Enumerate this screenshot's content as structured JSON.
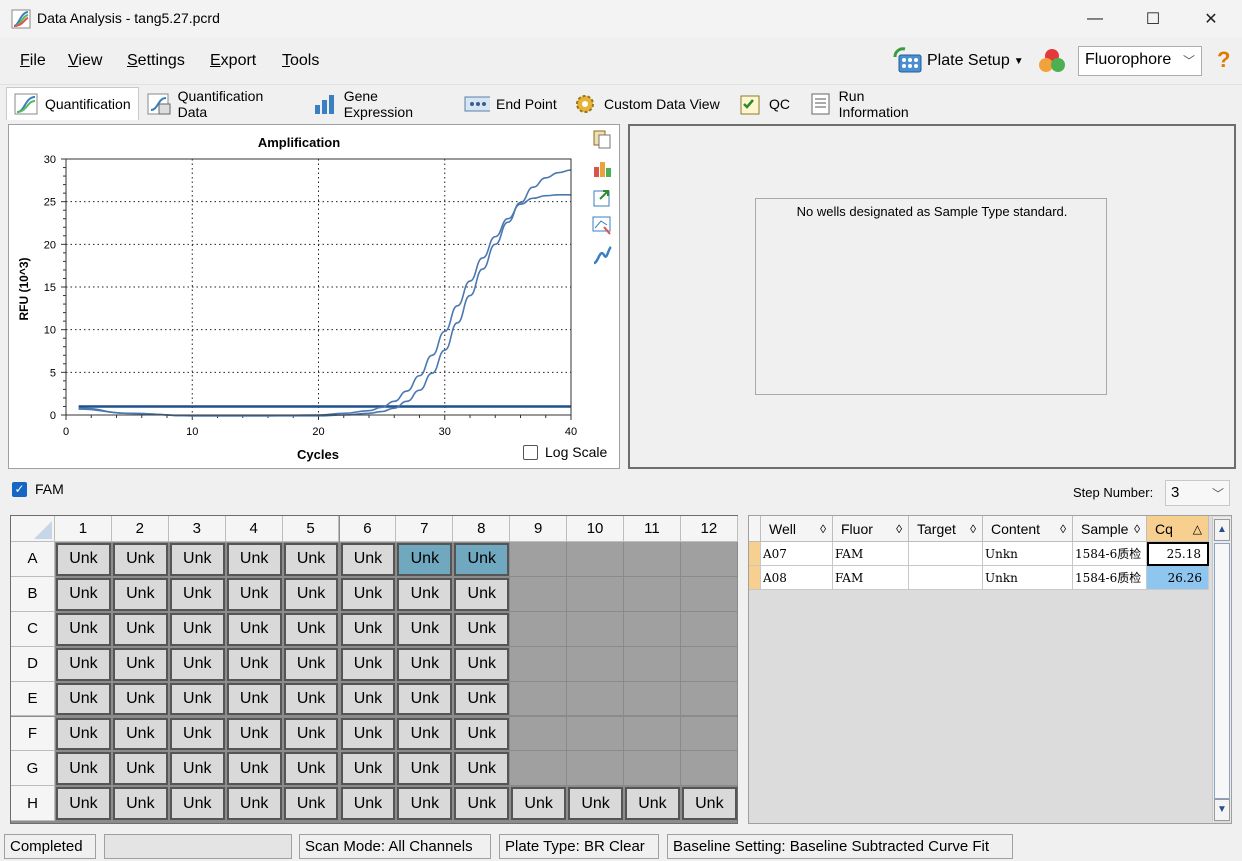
{
  "window": {
    "title": "Data Analysis - tang5.27.pcrd"
  },
  "menu": {
    "file": "File",
    "view": "View",
    "settings": "Settings",
    "export": "Export",
    "tools": "Tools",
    "plate_setup": "Plate Setup",
    "fluorophore": "Fluorophore",
    "help": "?"
  },
  "tabs": [
    "Quantification",
    "Quantification Data",
    "Gene Expression",
    "End Point",
    "Custom Data View",
    "QC",
    "Run Information"
  ],
  "chart": {
    "log_scale_label": "Log Scale"
  },
  "chart_data": {
    "type": "line",
    "title": "Amplification",
    "xlabel": "Cycles",
    "ylabel": "RFU (10^3)",
    "xlim": [
      0,
      40
    ],
    "ylim": [
      0,
      30
    ],
    "xticks": [
      0,
      10,
      20,
      30,
      40
    ],
    "yticks": [
      0,
      5,
      10,
      15,
      20,
      25,
      30
    ],
    "grid": true,
    "threshold": 1.0,
    "series": [
      {
        "x": [
          1,
          5,
          10,
          15,
          20,
          22,
          24,
          25,
          26,
          27,
          28,
          29,
          30,
          31,
          32,
          33,
          34,
          35,
          36,
          37,
          38,
          39,
          40
        ],
        "values": [
          0.7,
          0.2,
          -0.1,
          -0.1,
          0.0,
          0.2,
          0.5,
          0.9,
          1.6,
          2.8,
          4.6,
          7.0,
          9.8,
          12.8,
          15.7,
          18.4,
          20.9,
          23.0,
          24.7,
          25.4,
          25.7,
          25.8,
          25.8
        ]
      },
      {
        "x": [
          1,
          5,
          10,
          15,
          20,
          22,
          24,
          25,
          26,
          27,
          28,
          29,
          30,
          31,
          32,
          33,
          34,
          35,
          36,
          37,
          38,
          39,
          40
        ],
        "values": [
          0.8,
          0.2,
          -0.1,
          -0.1,
          -0.1,
          0.0,
          0.2,
          0.4,
          0.8,
          1.6,
          2.9,
          4.9,
          7.6,
          10.8,
          14.0,
          17.1,
          20.0,
          22.6,
          24.9,
          26.7,
          27.8,
          28.4,
          28.7
        ]
      }
    ]
  },
  "standard_panel": {
    "message": "No wells designated as Sample Type standard."
  },
  "fam": {
    "label": "FAM",
    "step_label": "Step Number:",
    "step_value": "3"
  },
  "plate": {
    "columns": [
      "1",
      "2",
      "3",
      "4",
      "5",
      "6",
      "7",
      "8",
      "9",
      "10",
      "11",
      "12"
    ],
    "rows": [
      "A",
      "B",
      "C",
      "D",
      "E",
      "F",
      "G",
      "H"
    ],
    "well_label": "Unk"
  },
  "results": {
    "headers": [
      "Well",
      "Fluor",
      "Target",
      "Content",
      "Sample",
      "Cq"
    ],
    "rows": [
      {
        "well": "A07",
        "fluor": "FAM",
        "target": "",
        "content": "Unkn",
        "sample": "1584-6质检",
        "cq": "25.18"
      },
      {
        "well": "A08",
        "fluor": "FAM",
        "target": "",
        "content": "Unkn",
        "sample": "1584-6质检",
        "cq": "26.26"
      }
    ]
  },
  "status": {
    "state": "Completed",
    "scan_mode": "Scan Mode: All Channels",
    "plate_type": "Plate Type: BR Clear",
    "baseline": "Baseline Setting: Baseline Subtracted Curve Fit"
  }
}
